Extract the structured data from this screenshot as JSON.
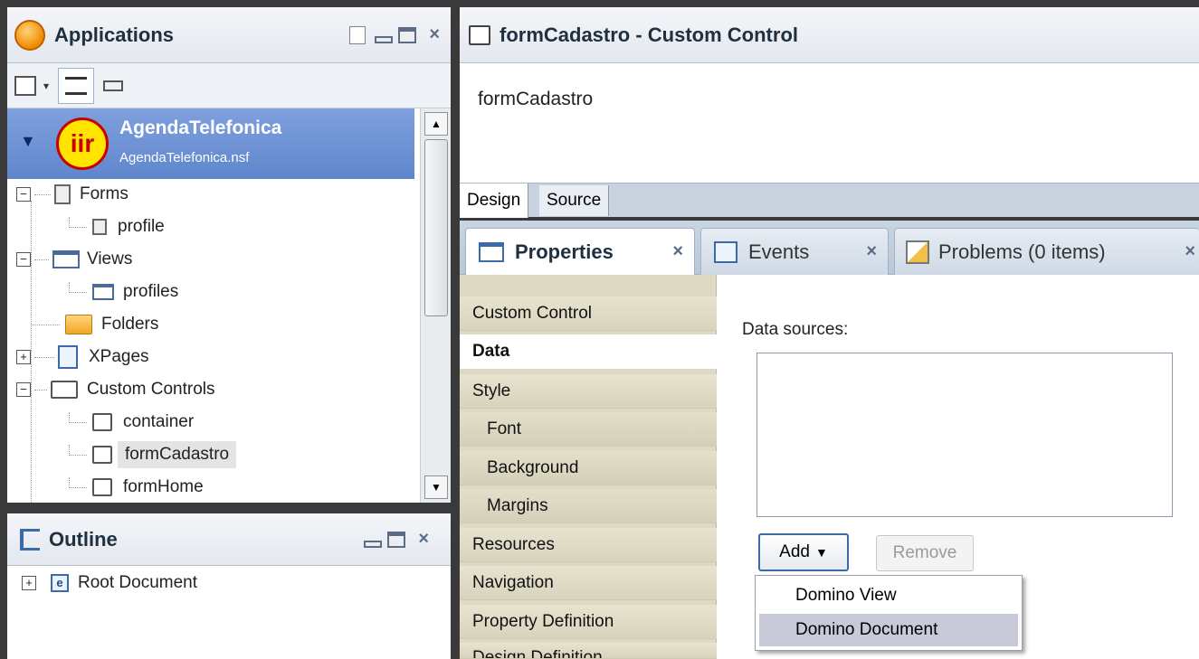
{
  "applications": {
    "title": "Applications",
    "app_name": "AgendaTelefonica",
    "app_file": "AgendaTelefonica.nsf",
    "tree": {
      "forms": "Forms",
      "profile": "profile",
      "views": "Views",
      "profiles": "profiles",
      "folders": "Folders",
      "xpages": "XPages",
      "custom_controls": "Custom Controls",
      "container": "container",
      "formCadastro": "formCadastro",
      "formHome": "formHome"
    }
  },
  "outline": {
    "title": "Outline",
    "root": "Root Document"
  },
  "editor": {
    "title": "formCadastro - Custom Control",
    "canvas_text": "formCadastro",
    "tabs": [
      "Design",
      "Source"
    ]
  },
  "bottom_tabs": {
    "properties": "Properties",
    "events": "Events",
    "problems": "Problems (0 items)"
  },
  "properties": {
    "categories": [
      "Custom Control",
      "Data",
      "Style",
      "Font",
      "Background",
      "Margins",
      "Resources",
      "Navigation",
      "Property Definition",
      "Design Definition"
    ],
    "data_sources_label": "Data sources:",
    "add_label": "Add",
    "remove_label": "Remove",
    "menu": [
      "Domino View",
      "Domino Document"
    ]
  },
  "colors": {
    "selection_blue": "#6f93d3",
    "header_blue": "#dfe6ef",
    "property_bg": "#ddd9c2",
    "menu_highlight": "#c8c9d9"
  }
}
